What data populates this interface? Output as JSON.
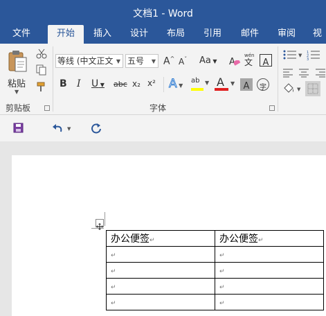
{
  "window": {
    "title": "文档1 - Word"
  },
  "tabs": [
    "文件",
    "开始",
    "插入",
    "设计",
    "布局",
    "引用",
    "邮件",
    "审阅",
    "视"
  ],
  "active_tab": "开始",
  "clipboard": {
    "paste_label": "粘贴",
    "group_label": "剪贴板"
  },
  "font": {
    "group_label": "字体",
    "font_name": "等线 (中文正文",
    "font_size": "五号",
    "bold": "B",
    "italic": "I",
    "underline": "U",
    "strike": "abc",
    "subscript": "x₂",
    "superscript": "x²",
    "change_case": "Aa",
    "phonetic_top": "wén",
    "phonetic_bottom": "文",
    "border_char": "A",
    "clear_char": "A",
    "grow_font": "A",
    "shrink_font": "A",
    "text_effect": "A",
    "font_color_char": "A",
    "char_shading": "A",
    "enclose": "字",
    "highlight_char": "ab"
  },
  "colors": {
    "brand": "#2b579a",
    "highlight": "#ffff00",
    "font_color": "#e02020"
  },
  "table": {
    "header": [
      "办公便签",
      "办公便签"
    ],
    "para_mark": "↵",
    "empty_rows": 4
  },
  "icons": {
    "paste": "paste-icon",
    "cut": "scissors-icon",
    "copy": "copy-icon",
    "format_painter": "paintbrush-icon",
    "save": "save-icon",
    "undo": "undo-icon",
    "redo": "redo-icon",
    "table_move": "move-handle-icon"
  }
}
